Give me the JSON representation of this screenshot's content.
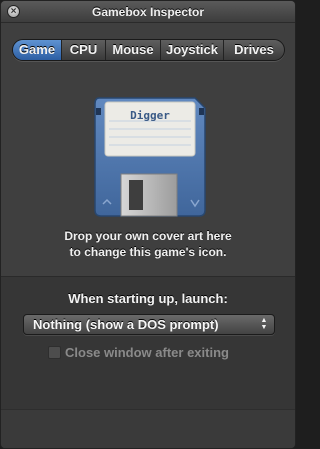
{
  "window": {
    "title": "Gamebox Inspector",
    "close_glyph": "×"
  },
  "tabs": [
    {
      "label": "Game",
      "active": true
    },
    {
      "label": "CPU",
      "active": false
    },
    {
      "label": "Mouse",
      "active": false
    },
    {
      "label": "Joystick",
      "active": false
    },
    {
      "label": "Drives",
      "active": false
    }
  ],
  "game": {
    "icon": "floppy-disk-icon",
    "disk_label": "Digger",
    "caption_line1": "Drop your own cover art here",
    "caption_line2": "to change this game's icon."
  },
  "launch": {
    "label": "When starting up, launch:",
    "selected": "Nothing (show a DOS prompt)",
    "close_after_exit_label": "Close window after exiting",
    "close_after_exit_checked": false,
    "close_after_exit_enabled": false
  },
  "colors": {
    "active_tab": "#3d72bd",
    "disk_body": "#4f75a9",
    "label_paper": "#ecebe6"
  }
}
